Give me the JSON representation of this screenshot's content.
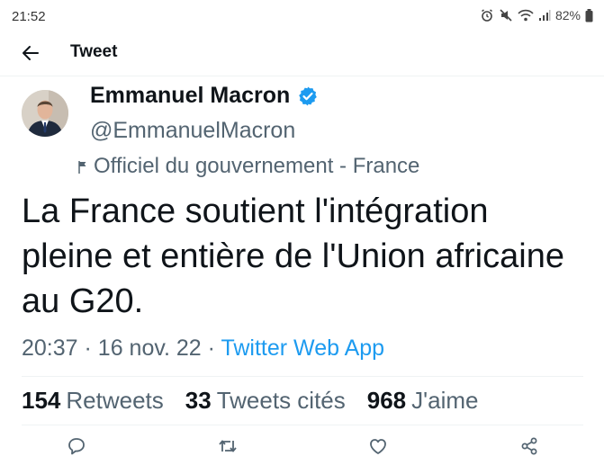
{
  "status_bar": {
    "time": "21:52",
    "battery": "82%",
    "icons": [
      "alarm-icon",
      "mute-icon",
      "wifi-icon",
      "signal-icon",
      "battery-icon"
    ]
  },
  "top_bar": {
    "title": "Tweet",
    "back_icon": "back-arrow-icon"
  },
  "tweet": {
    "author_name": "Emmanuel Macron",
    "handle": "@EmmanuelMacron",
    "affiliation": "Officiel du gouvernement - France",
    "text": "La France soutient l'intégration pleine et entière de l'Union africaine au G20.",
    "time": "20:37",
    "separator": "·",
    "date": "16 nov. 22",
    "source": "Twitter Web App",
    "stats": {
      "retweets_count": "154",
      "retweets_label": "Retweets",
      "quotes_count": "33",
      "quotes_label": "Tweets cités",
      "likes_count": "968",
      "likes_label": "J'aime"
    }
  },
  "actions": [
    "reply-icon",
    "retweet-icon",
    "like-icon",
    "share-icon"
  ],
  "colors": {
    "text": "#0f1419",
    "secondary": "#536471",
    "link": "#1d9bf0",
    "verified": "#1d9bf0",
    "divider": "#eff3f4"
  }
}
